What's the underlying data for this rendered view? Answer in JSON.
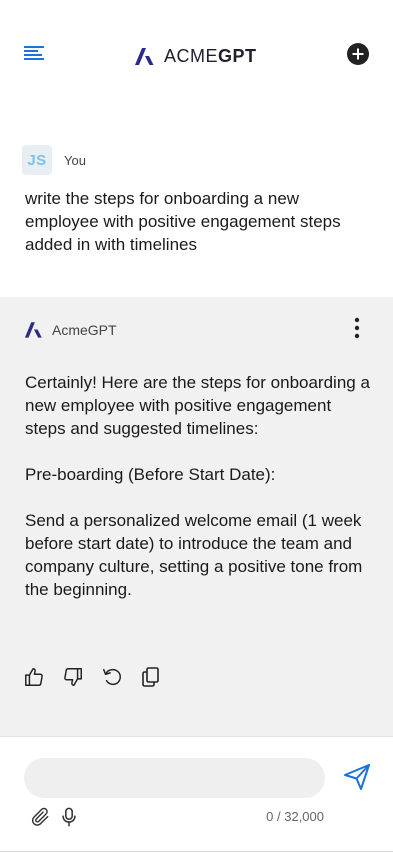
{
  "header": {
    "brand_text_light": "ACME",
    "brand_text_bold": "GPT",
    "menu_icon": "menu-lines-icon",
    "new_chat_icon": "plus-circle-icon"
  },
  "user_message": {
    "initials": "JS",
    "author": "You",
    "text": "write the steps for onboarding a new employee with positive engagement steps added in with timelines"
  },
  "assistant_message": {
    "author": "AcmeGPT",
    "paragraphs": [
      "Certainly! Here are the steps for onboarding a new employee with positive engagement steps and suggested timelines:",
      "Pre-boarding (Before Start Date):",
      "Send a personalized welcome email (1 week before start date) to introduce the team and company culture, setting a positive tone from the beginning."
    ],
    "actions": [
      "thumbs-up-icon",
      "thumbs-down-icon",
      "regenerate-icon",
      "copy-icon"
    ]
  },
  "composer": {
    "value": "",
    "placeholder": "",
    "counter": "0 / 32,000"
  },
  "colors": {
    "accent_blue": "#1a73d9",
    "brand_logo": "#2b2a8c",
    "response_background": "#f1f1f1",
    "avatar_text": "#7cc3e6"
  }
}
